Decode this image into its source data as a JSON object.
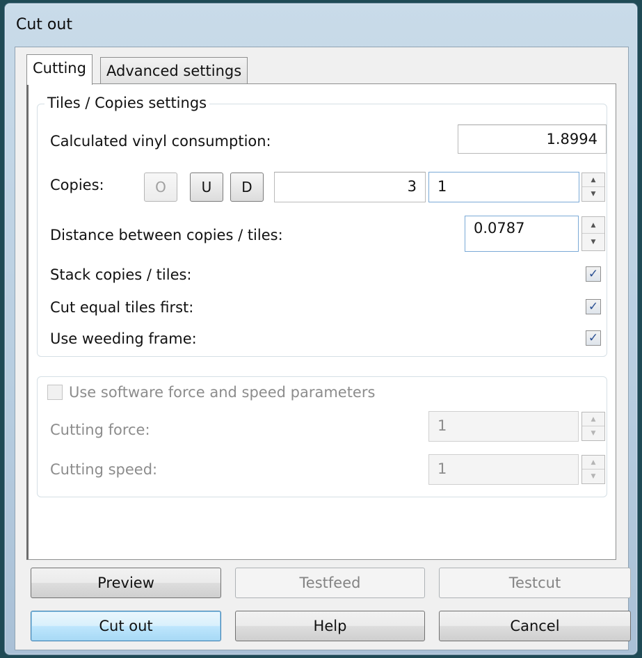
{
  "window": {
    "title": "Cut out"
  },
  "tabs": [
    {
      "label": "Cutting",
      "active": true
    },
    {
      "label": "Advanced settings",
      "active": false
    }
  ],
  "tiles_group": {
    "legend": "Tiles / Copies settings",
    "vinyl_label": "Calculated vinyl consumption:",
    "vinyl_value": "1.8994",
    "copies_label": "Copies:",
    "copies_buttons": [
      "O",
      "U",
      "D"
    ],
    "copies_value": "3",
    "copies_spin_value": "1",
    "distance_label": "Distance between copies / tiles:",
    "distance_value": "0.0787",
    "stack_label": "Stack copies / tiles:",
    "stack_checked": true,
    "equal_label": "Cut equal tiles first:",
    "equal_checked": true,
    "weeding_label": "Use weeding frame:",
    "weeding_checked": true
  },
  "software_group": {
    "checkbox_label": "Use software force and speed parameters",
    "checked": false,
    "force_label": "Cutting force:",
    "force_value": "1",
    "speed_label": "Cutting speed:",
    "speed_value": "1"
  },
  "buttons": {
    "preview": "Preview",
    "testfeed": "Testfeed",
    "testcut": "Testcut",
    "cutout": "Cut out",
    "help": "Help",
    "cancel": "Cancel"
  },
  "icons": {
    "check": "✓",
    "spin_up": "▲",
    "spin_down": "▼"
  }
}
